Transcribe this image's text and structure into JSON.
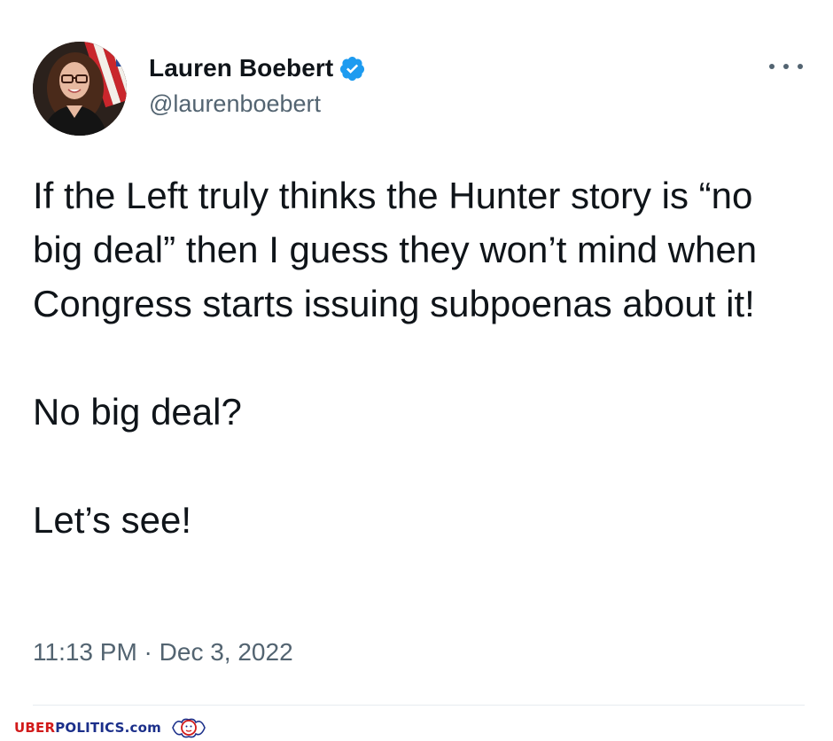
{
  "tweet": {
    "author": {
      "display_name": "Lauren Boebert",
      "handle": "@laurenboebert",
      "verified": true,
      "avatar_icon": "profile-photo"
    },
    "body_paragraphs": [
      "If the Left truly thinks the Hunter story is “no big deal” then I guess they won’t mind when Congress starts issuing subpoenas about it!",
      "No big deal?",
      "Let’s see!"
    ],
    "timestamp": "11:13 PM · Dec 3, 2022",
    "menu_icon": "more-options-icon"
  },
  "watermark": {
    "part_red": "UBER",
    "part_blue": "POLITICS.com",
    "logo_icon": "lion-crest-icon"
  },
  "colors": {
    "verified_blue": "#1d9bf0",
    "text_primary": "#0f1419",
    "text_secondary": "#536471",
    "watermark_red": "#d11a1a",
    "watermark_blue": "#1b2f8a"
  }
}
